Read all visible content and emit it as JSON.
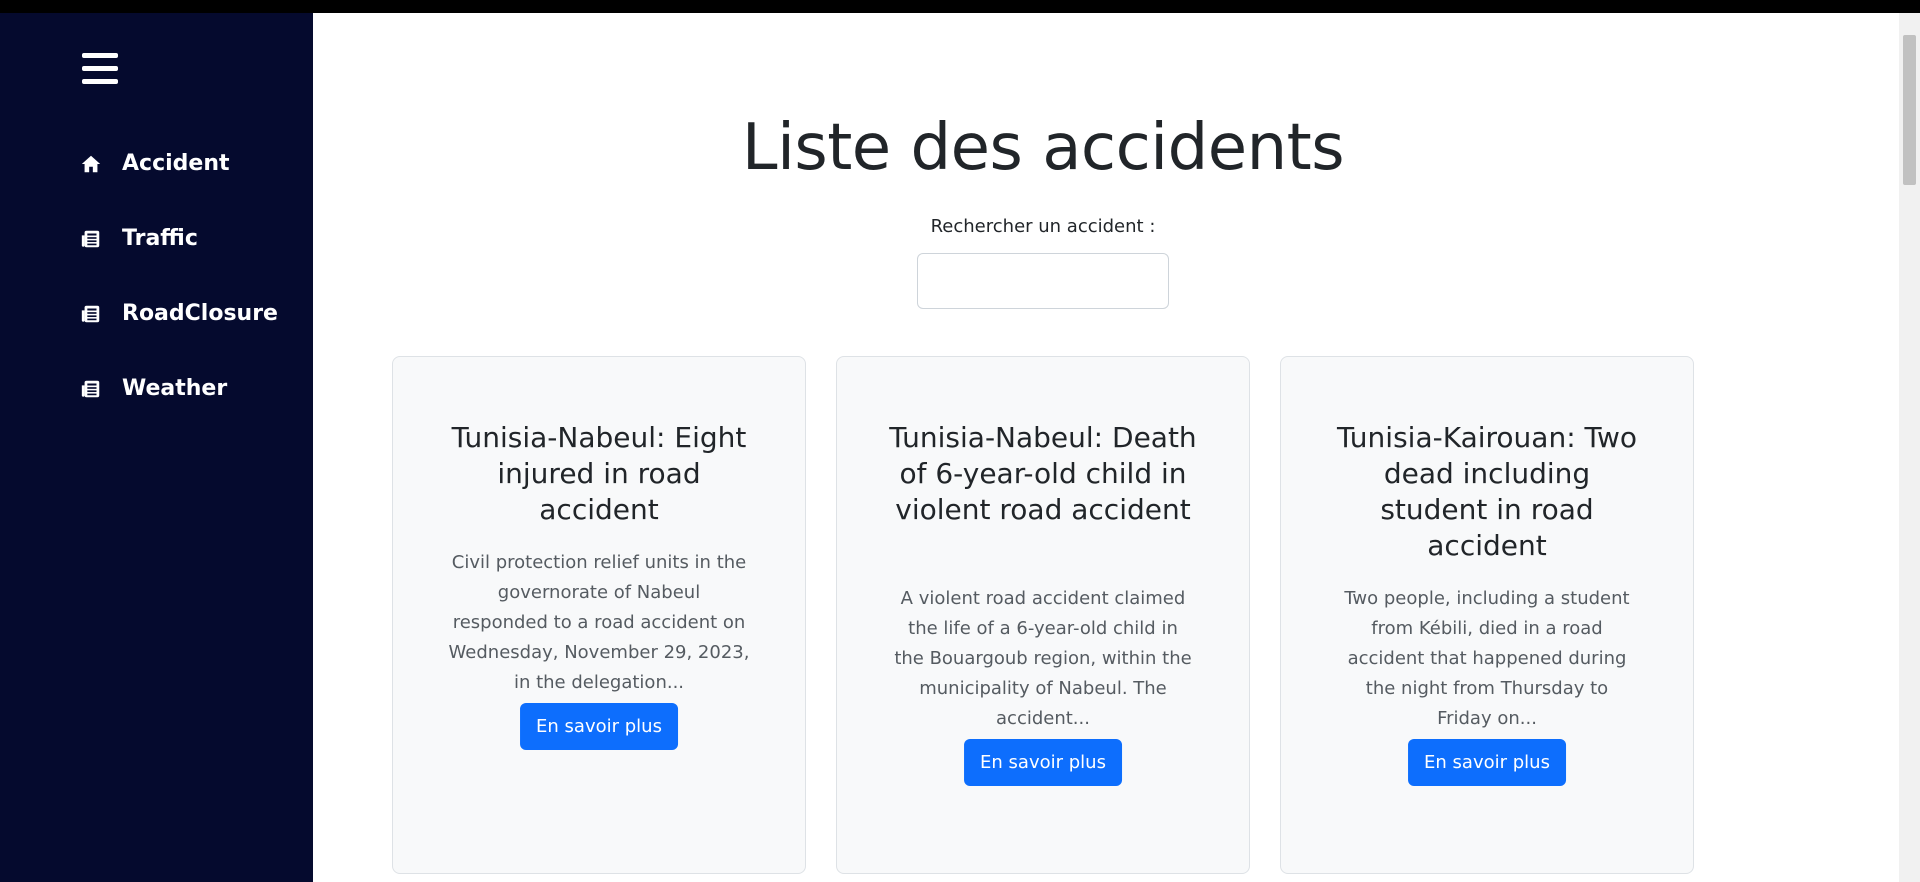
{
  "sidebar": {
    "menu_icon": "hamburger-menu-icon",
    "items": [
      {
        "label": "Accident",
        "icon": "home-icon"
      },
      {
        "label": "Traffic",
        "icon": "newspaper-icon"
      },
      {
        "label": "RoadClosure",
        "icon": "newspaper-icon"
      },
      {
        "label": "Weather",
        "icon": "newspaper-icon"
      }
    ]
  },
  "main": {
    "title": "Liste des accidents",
    "search": {
      "label": "Rechercher un accident :",
      "value": "",
      "placeholder": ""
    },
    "cards": [
      {
        "title": "Tunisia-Nabeul: Eight injured in road accident",
        "excerpt": "Civil protection relief units in the governorate of Nabeul responded to a road accident on Wednesday, November 29, 2023, in the delegation...",
        "button": "En savoir plus"
      },
      {
        "title": "Tunisia-Nabeul: Death of 6-year-old child in violent road accident",
        "excerpt": "A violent road accident claimed the life of a 6-year-old child in the Bouargoub region, within the municipality of Nabeul. The accident...",
        "button": "En savoir plus"
      },
      {
        "title": "Tunisia-Kairouan: Two dead including student in road accident",
        "excerpt": "Two people, including a student from Kébili, died in a road accident that happened during the night from Thursday to Friday on...",
        "button": "En savoir plus"
      }
    ]
  },
  "colors": {
    "sidebar_bg": "#050a2e",
    "primary_button": "#0d6efd",
    "card_bg": "#f8f9fa"
  }
}
